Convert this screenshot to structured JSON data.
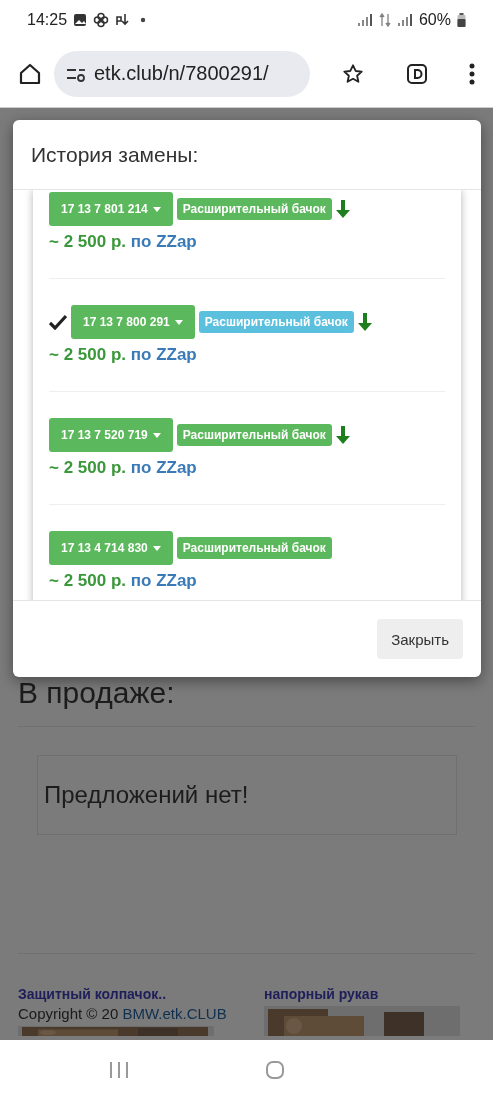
{
  "status_bar": {
    "time": "14:25",
    "battery": "60%"
  },
  "browser": {
    "url": "etk.club/n/7800291/"
  },
  "modal": {
    "title": "История замены:",
    "items": [
      {
        "part_number": "17 13 7 801 214",
        "name": "Расширительный бачок",
        "current": false,
        "arrow": true,
        "price": "~ 2 500 р.",
        "source_link": "по ZZap"
      },
      {
        "part_number": "17 13 7 800 291",
        "name": "Расширительный бачок",
        "current": true,
        "arrow": true,
        "price": "~ 2 500 р.",
        "source_link": "по ZZap"
      },
      {
        "part_number": "17 13 7 520 719",
        "name": "Расширительный бачок",
        "current": false,
        "arrow": true,
        "price": "~ 2 500 р.",
        "source_link": "по ZZap"
      },
      {
        "part_number": "17 13 4 714 830",
        "name": "Расширительный бачок",
        "current": false,
        "arrow": false,
        "price": "~ 2 500 р.",
        "source_link": "по ZZap"
      }
    ],
    "close_button": "Закрыть"
  },
  "page": {
    "section_title": "В продаже:",
    "empty_message": "Предложений нет!",
    "related": [
      {
        "title": "Защитный колпачок.."
      },
      {
        "title": "напорный рукав"
      }
    ],
    "copyright": "Copyright © 20",
    "site_link": "BMW.etk.CLUB"
  }
}
